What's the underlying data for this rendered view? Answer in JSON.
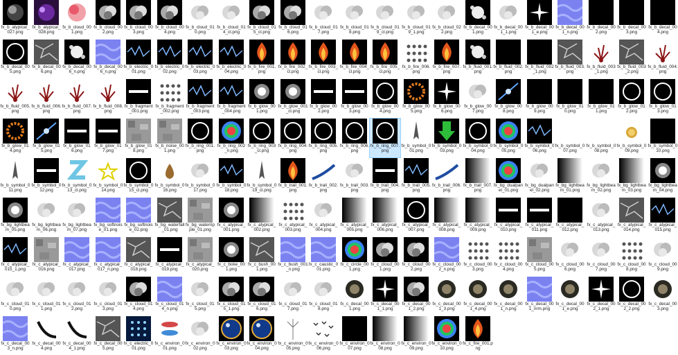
{
  "files": [
    {
      "name": "fx_b_atypical_027.png",
      "thumb": "atyp"
    },
    {
      "name": "fx_b_atypical_028.png",
      "thumb": "violet"
    },
    {
      "name": "fx_b_cloud_001.png",
      "thumb": "pinkcloud"
    },
    {
      "name": "fx_b_cloud_002.png",
      "thumb": "cloud"
    },
    {
      "name": "fx_b_cloud_003.png",
      "thumb": "cloud"
    },
    {
      "name": "fx_b_cloud_004.png",
      "thumb": "cloud"
    },
    {
      "name": "fx_b_cloud_010.png",
      "thumb": "wcloud"
    },
    {
      "name": "fx_b_cloud_014_cl.png",
      "thumb": "wcloud"
    },
    {
      "name": "fx_b_cloud_015_cl.png",
      "thumb": "cloud"
    },
    {
      "name": "fx_b_cloud_016.png",
      "thumb": "cloud"
    },
    {
      "name": "fx_b_cloud_017.png",
      "thumb": "wcloud"
    },
    {
      "name": "fx_b_cloud_018.png",
      "thumb": "wcloud"
    },
    {
      "name": "fx_b_cloud_019_cl.png",
      "thumb": "wcloud"
    },
    {
      "name": "fx_b_cloud_019_1.png",
      "thumb": "wcloud"
    },
    {
      "name": "fx_b_cloud_022.png",
      "thumb": "wcloud"
    },
    {
      "name": "fx_b_decal_001.png",
      "thumb": "splat"
    },
    {
      "name": "fx_b_decal_001_1.png",
      "thumb": "wcloud"
    },
    {
      "name": "fx_b_decal_001_e.png",
      "thumb": "spark"
    },
    {
      "name": "fx_b_decal_001_n.png",
      "thumb": "normal"
    },
    {
      "name": "fx_b_decal_002.png",
      "thumb": "dark"
    },
    {
      "name": "fx_b_decal_003.png",
      "thumb": "dark"
    },
    {
      "name": "fx_b_decal_004.png",
      "thumb": "dark"
    },
    {
      "name": "fx_b_decal_005.png",
      "thumb": "ring"
    },
    {
      "name": "fx_b_decal_006.png",
      "thumb": "crack"
    },
    {
      "name": "fx_b_decal_006_n.png",
      "thumb": "splat"
    },
    {
      "name": "fx_b_decal_006_n.png",
      "thumb": "normal"
    },
    {
      "name": "fx_b_electric_001.png",
      "thumb": "elec"
    },
    {
      "name": "fx_b_electric_002.png",
      "thumb": "elec"
    },
    {
      "name": "fx_b_electric_003.png",
      "thumb": "elec"
    },
    {
      "name": "fx_b_electric_004.png",
      "thumb": "elec"
    },
    {
      "name": "fx_b_fire_001.png",
      "thumb": "fire"
    },
    {
      "name": "fx_b_fire_002_cl.png",
      "thumb": "fire"
    },
    {
      "name": "fx_b_fire_003_cl.png",
      "thumb": "fire"
    },
    {
      "name": "fx_b_fire_004_cl.png",
      "thumb": "fire"
    },
    {
      "name": "fx_b_fire_005_cl.png",
      "thumb": "fire"
    },
    {
      "name": "fx_b_fire_006.png",
      "thumb": "dots"
    },
    {
      "name": "fx_b_fire_007.png",
      "thumb": "fire"
    },
    {
      "name": "fx_b_fluid_001.png",
      "thumb": "splat"
    },
    {
      "name": "fx_b_fluid_002.png",
      "thumb": "dark"
    },
    {
      "name": "fx_b_fluid_002_1.png",
      "thumb": "dark"
    },
    {
      "name": "fx_b_fluid_003.png",
      "thumb": "crack"
    },
    {
      "name": "fx_b_fluid_003_1.png",
      "thumb": "blood"
    },
    {
      "name": "fx_b_fluid_003_2.png",
      "thumb": "crack"
    },
    {
      "name": "fx_b_fluid_004.png",
      "thumb": "blood"
    },
    {
      "name": "fx_b_fluid_005.png",
      "thumb": "blood"
    },
    {
      "name": "fx_b_fluid_006.png",
      "thumb": "blood"
    },
    {
      "name": "fx_b_fluid_007.png",
      "thumb": "blood"
    },
    {
      "name": "fx_b_fluid_008.png",
      "thumb": "blood"
    },
    {
      "name": "fx_b_fragment_001.png",
      "thumb": "line"
    },
    {
      "name": "fx_b_fragment_002.png",
      "thumb": "dots"
    },
    {
      "name": "fx_b_fragment_003.png",
      "thumb": "elec"
    },
    {
      "name": "fx_b_fragment_004.png",
      "thumb": "elec"
    },
    {
      "name": "fx_b_glow_001.png",
      "thumb": "glow"
    },
    {
      "name": "fx_b_glow_001_cl.png",
      "thumb": "glow"
    },
    {
      "name": "fx_b_glow_002.png",
      "thumb": "line"
    },
    {
      "name": "fx_b_glow_003.png",
      "thumb": "line"
    },
    {
      "name": "fx_b_glow_004.png",
      "thumb": "ring"
    },
    {
      "name": "fx_b_glow_005.png",
      "thumb": "orangestar"
    },
    {
      "name": "fx_b_glow_006.png",
      "thumb": "spark"
    },
    {
      "name": "fx_b_glow_007.png",
      "thumb": "wcloud"
    },
    {
      "name": "fx_b_glow_008.png",
      "thumb": "blueglow"
    },
    {
      "name": "fx_b_glow_009.png",
      "thumb": "dark"
    },
    {
      "name": "fx_b_glow_010.png",
      "thumb": "dark"
    },
    {
      "name": "fx_b_glow_011.png",
      "thumb": "dark"
    },
    {
      "name": "fx_b_glow_012.png",
      "thumb": "ring"
    },
    {
      "name": "fx_b_glow_013.png",
      "thumb": "ring"
    },
    {
      "name": "fx_b_glow_014.png",
      "thumb": "orangestar"
    },
    {
      "name": "fx_b_glow_015.png",
      "thumb": "blueglow"
    },
    {
      "name": "fx_b_glow_016.png",
      "thumb": "line"
    },
    {
      "name": "fx_b_glow_017.png",
      "thumb": "line"
    },
    {
      "name": "fx_b_glow_018.png",
      "thumb": "noise"
    },
    {
      "name": "fx_b_noise_001.png",
      "thumb": "noise"
    },
    {
      "name": "fx_b_ring_001.png",
      "thumb": "ring"
    },
    {
      "name": "fx_b_ring_002_n.png",
      "thumb": "rainbow"
    },
    {
      "name": "fx_b_ring_003_cl.png",
      "thumb": "ring"
    },
    {
      "name": "fx_b_ring_004.png",
      "thumb": "ring"
    },
    {
      "name": "fx_b_ring_005.png",
      "thumb": "ring"
    },
    {
      "name": "fx_b_ring_006.png",
      "thumb": "ring"
    },
    {
      "name": "fx_b_ring_007.png",
      "thumb": "ring"
    },
    {
      "name": "fx_b_symbol_001.png",
      "thumb": "symbol"
    },
    {
      "name": "fx_b_symbol_003.png",
      "thumb": "arrow"
    },
    {
      "name": "fx_b_symbol_004.png",
      "thumb": "ring"
    },
    {
      "name": "fx_b_symbol_005.png",
      "thumb": "rainbow"
    },
    {
      "name": "fx_b_symbol_006.png",
      "thumb": "elec"
    },
    {
      "name": "fx_b_symbol_007.png",
      "thumb": "blank"
    },
    {
      "name": "fx_b_symbol_008.png",
      "thumb": "blank"
    },
    {
      "name": "fx_b_symbol_009.png",
      "thumb": "coin"
    },
    {
      "name": "fx_b_symbol_010.png",
      "thumb": "dark"
    },
    {
      "name": "fx_b_symbol_011.png",
      "thumb": "symbol"
    },
    {
      "name": "fx_b_symbol_012.png",
      "thumb": "line"
    },
    {
      "name": "fx_b_symbol_013_cl.png",
      "thumb": "zed"
    },
    {
      "name": "fx_b_symbol_014.png",
      "thumb": "star"
    },
    {
      "name": "fx_b_symbol_015_cl.png",
      "thumb": "ring"
    },
    {
      "name": "fx_b_symbol_016.png",
      "thumb": "drop"
    },
    {
      "name": "fx_b_symbol_017.png",
      "thumb": "wcloud"
    },
    {
      "name": "fx_b_symbol_018.png",
      "thumb": "elec"
    },
    {
      "name": "fx_b_symbol_019_cl.png",
      "thumb": "symbol"
    },
    {
      "name": "fx_b_trail_001.png",
      "thumb": "fire"
    },
    {
      "name": "fx_b_trail_002.png",
      "thumb": "trail"
    },
    {
      "name": "fx_b_trail_003.png",
      "thumb": "wcloud"
    },
    {
      "name": "fx_b_trail_004.png",
      "thumb": "line"
    },
    {
      "name": "fx_b_trail_005.png",
      "thumb": "elec"
    },
    {
      "name": "fx_b_trail_006.png",
      "thumb": "trail"
    },
    {
      "name": "fx_b_trail_007.png",
      "thumb": "grad"
    },
    {
      "name": "fx_bg_dualpanel_01.png",
      "thumb": "rainbow"
    },
    {
      "name": "fx_bg_dualpanel_02.png",
      "thumb": "wcloud"
    },
    {
      "name": "fx_bg_lightbeam_01.png",
      "thumb": "grad"
    },
    {
      "name": "fx_bg_lightbeam_02.png",
      "thumb": "wcloud"
    },
    {
      "name": "fx_bg_lightbeam_03.png",
      "thumb": "grad"
    },
    {
      "name": "fx_bg_lightbeam_04.png",
      "thumb": "glow"
    },
    {
      "name": "fx_bg_lightbeam_05.png",
      "thumb": "glow"
    },
    {
      "name": "fx_bg_lightbeam_06.png",
      "thumb": "wcloud"
    },
    {
      "name": "fx_bg_lightbeam_07.png",
      "thumb": "wcloud"
    },
    {
      "name": "fx_bg_softnoise_01.png",
      "thumb": "normal"
    },
    {
      "name": "fx_bg_softnoise_02.png",
      "thumb": "normal"
    },
    {
      "name": "fx_bg_waterfall_01.png",
      "thumb": "crack"
    },
    {
      "name": "fx_bg_waterripple_01.png",
      "thumb": "noise"
    },
    {
      "name": "fx_c_atypical_001.png",
      "thumb": "glow"
    },
    {
      "name": "fx_c_atypical_002.png",
      "thumb": "grad"
    },
    {
      "name": "fx_c_atypical_003.png",
      "thumb": "dots"
    },
    {
      "name": "fx_c_atypical_004.png",
      "thumb": "wcloud"
    },
    {
      "name": "fx_c_atypical_005.png",
      "thumb": "grad"
    },
    {
      "name": "fx_c_atypical_006.png",
      "thumb": "grad"
    },
    {
      "name": "fx_c_atypical_007.png",
      "thumb": "ring"
    },
    {
      "name": "fx_c_atypical_008.png",
      "thumb": "grad"
    },
    {
      "name": "fx_c_atypical_009.png",
      "thumb": "grad"
    },
    {
      "name": "fx_c_atypical_010.png",
      "thumb": "line"
    },
    {
      "name": "fx_c_atypical_011.png",
      "thumb": "line"
    },
    {
      "name": "fx_c_atypical_012.png",
      "thumb": "dark"
    },
    {
      "name": "fx_c_atypical_013.png",
      "thumb": "wcloud"
    },
    {
      "name": "fx_c_atypical_014.png",
      "thumb": "crack"
    },
    {
      "name": "fx_c_atypical_015.png",
      "thumb": "elec"
    },
    {
      "name": "fx_c_atypical_015_1.png",
      "thumb": "elec"
    },
    {
      "name": "fx_c_atypical_016.png",
      "thumb": "noise"
    },
    {
      "name": "fx_c_atypical_017.png",
      "thumb": "normal"
    },
    {
      "name": "fx_c_atypical_017_n.png",
      "thumb": "normal"
    },
    {
      "name": "fx_c_atypical_018.png",
      "thumb": "crack"
    },
    {
      "name": "fx_c_atypical_019.png",
      "thumb": "line"
    },
    {
      "name": "fx_c_atypical_020.png",
      "thumb": "noise"
    },
    {
      "name": "fx_c_boke_001.png",
      "thumb": "glow"
    },
    {
      "name": "fx_c_bush_001.png",
      "thumb": "crack"
    },
    {
      "name": "fx_c_bush_001_n.png",
      "thumb": "normal"
    },
    {
      "name": "fx_c_caustic_001.png",
      "thumb": "normal"
    },
    {
      "name": "fx_c_circle_001.png",
      "thumb": "rainbow"
    },
    {
      "name": "fx_c_cloud_001.png",
      "thumb": "cloud"
    },
    {
      "name": "fx_c_cloud_002.png",
      "thumb": "cloud"
    },
    {
      "name": "fx_c_cloud_002_n.png",
      "thumb": "normal"
    },
    {
      "name": "fx_c_cloud_003.png",
      "thumb": "dots"
    },
    {
      "name": "fx_c_cloud_004.png",
      "thumb": "dots"
    },
    {
      "name": "fx_c_cloud_005.png",
      "thumb": "noise"
    },
    {
      "name": "fx_c_cloud_006.png",
      "thumb": "wcloud"
    },
    {
      "name": "fx_c_cloud_007.png",
      "thumb": "wcloud"
    },
    {
      "name": "fx_c_cloud_008.png",
      "thumb": "dots"
    },
    {
      "name": "fx_c_cloud_009.png",
      "thumb": "wcloud"
    },
    {
      "name": "fx_c_cloud_010.png",
      "thumb": "wcloud"
    },
    {
      "name": "fx_c_cloud_011.png",
      "thumb": "wcloud"
    },
    {
      "name": "fx_c_cloud_012.png",
      "thumb": "wcloud"
    },
    {
      "name": "fx_c_cloud_013.png",
      "thumb": "wcloud"
    },
    {
      "name": "fx_c_cloud_014.png",
      "thumb": "cloud"
    },
    {
      "name": "fx_c_cloud_014_n.png",
      "thumb": "normal"
    },
    {
      "name": "fx_c_cloud_015.png",
      "thumb": "wcloud"
    },
    {
      "name": "fx_c_cloud_015_1.png",
      "thumb": "cloud"
    },
    {
      "name": "fx_c_cloud_016.png",
      "thumb": "cloud"
    },
    {
      "name": "fx_c_cloud_017.png",
      "thumb": "wcloud"
    },
    {
      "name": "fx_c_cloud_018.png",
      "thumb": "wcloud"
    },
    {
      "name": "fx_c_decal_001.png",
      "thumb": "burst"
    },
    {
      "name": "fx_c_decal_001_1.png",
      "thumb": "spark"
    },
    {
      "name": "fx_c_decal_001_2.png",
      "thumb": "cloud"
    },
    {
      "name": "fx_c_decal_001_3.png",
      "thumb": "burst"
    },
    {
      "name": "fx_c_decal_001_4.png",
      "thumb": "burst"
    },
    {
      "name": "fx_c_decal_001_n.png",
      "thumb": "burst"
    },
    {
      "name": "fx_c_decal_001_nrm.png",
      "thumb": "normal"
    },
    {
      "name": "fx_c_decal_001_e.png",
      "thumb": "burst"
    },
    {
      "name": "fx_c_decal_002_1.png",
      "thumb": "spark"
    },
    {
      "name": "fx_c_decal_002_2.png",
      "thumb": "ring"
    },
    {
      "name": "fx_c_decal_003.png",
      "thumb": "burst"
    },
    {
      "name": "fx_c_decal_003_n.png",
      "thumb": "normal"
    },
    {
      "name": "fx_c_decal_004.png",
      "thumb": "arc"
    },
    {
      "name": "fx_c_decal_004_1.png",
      "thumb": "arc"
    },
    {
      "name": "fx_c_decal_005.png",
      "thumb": "crack"
    },
    {
      "name": "fx_c_electric_001.png",
      "thumb": "bluedots"
    },
    {
      "name": "fx_c_environ_001.png",
      "thumb": "fish"
    },
    {
      "name": "fx_c_environ_002.png",
      "thumb": "wcloud"
    },
    {
      "name": "fx_c_environ_003.png",
      "thumb": "bubble"
    },
    {
      "name": "fx_c_environ_004.png",
      "thumb": "bubble"
    },
    {
      "name": "fx_c_environ_005.png",
      "thumb": "dandelion"
    },
    {
      "name": "fx_c_environ_006.png",
      "thumb": "birds"
    },
    {
      "name": "fx_c_environ_007.png",
      "thumb": "dark"
    },
    {
      "name": "fx_c_environ_008.png",
      "thumb": "grad"
    },
    {
      "name": "fx_c_environ_009.png",
      "thumb": "grad"
    },
    {
      "name": "fx_c_environ_010.png",
      "thumb": "rainbow"
    },
    {
      "name": "fx_c_fire_001.png",
      "thumb": "fire"
    }
  ],
  "selected_file": "fx_b_ring_007.png",
  "colors": {
    "selection_bg": "#cce8ff",
    "selection_border": "#99d1ff",
    "caption": "#222222"
  }
}
